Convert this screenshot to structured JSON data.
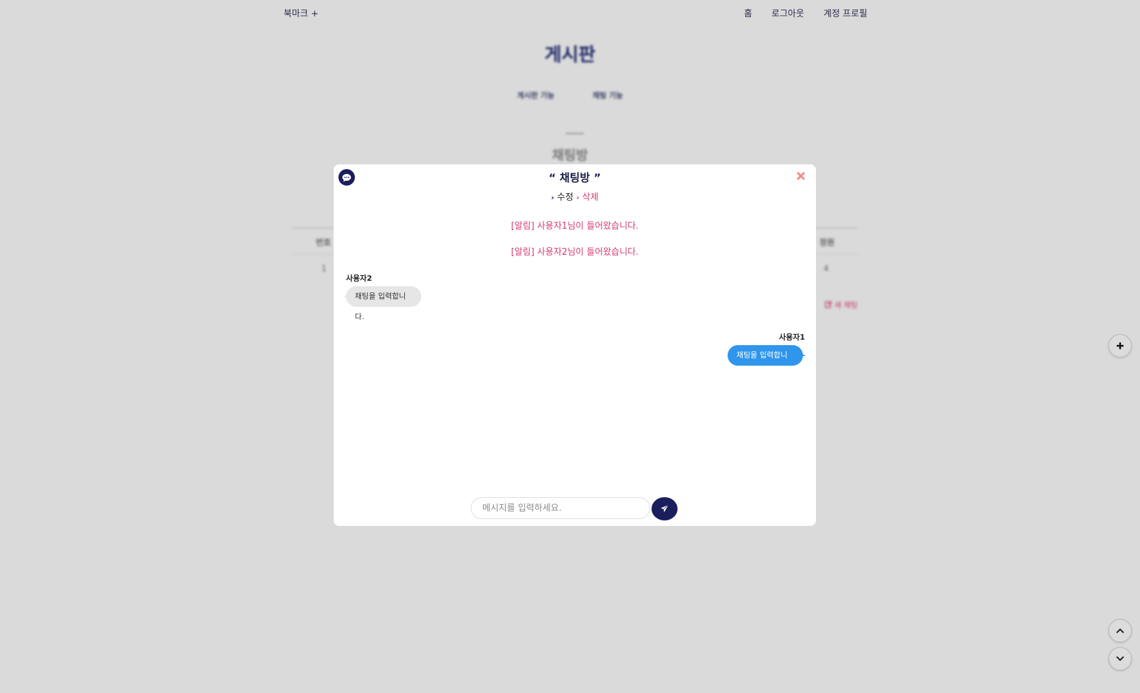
{
  "nav": {
    "bookmark": "북마크 +",
    "home": "홈",
    "logout": "로그아웃",
    "profile": "계정 프로필"
  },
  "page": {
    "title": "게시판",
    "tabs": [
      "게시판 기능",
      "채팅 기능"
    ],
    "section_title": "채팅방",
    "table": {
      "col_first": "번호",
      "col_last": "정원",
      "row_first": "1",
      "row_last": "4"
    },
    "new_chat": "새 채팅"
  },
  "modal": {
    "title": "“ 채팅방 ”",
    "edit": "수정",
    "delete": "삭제",
    "notices": [
      "[알림] 사용자1님이 들어왔습니다.",
      "[알림] 사용자2님이 들어왔습니다."
    ],
    "messages": [
      {
        "sender": "사용자2",
        "text": "채팅을 입력합니다.",
        "side": "left"
      },
      {
        "sender": "사용자1",
        "text": "채팅을 입력합니다.",
        "side": "right"
      }
    ],
    "input": {
      "placeholder": "메시지를 입력하세요.",
      "value": ""
    }
  },
  "colors": {
    "navy": "#1a1e5c",
    "pink": "#d63b72",
    "blue_bubble": "#2f96ec",
    "gray_bubble": "#e6e6e6",
    "overlay": "#dadada"
  },
  "icons": [
    "chat-icon",
    "close-icon",
    "chevron-right-icon",
    "send-icon",
    "plus-icon",
    "chevron-up-icon",
    "chevron-down-icon",
    "edit-icon"
  ]
}
